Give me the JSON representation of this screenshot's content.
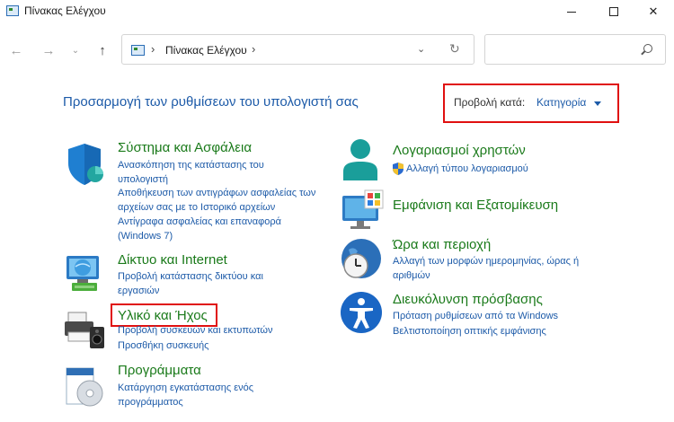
{
  "window": {
    "title": "Πίνακας Ελέγχου",
    "minimize": "─",
    "close": "✕"
  },
  "nav": {
    "back": "←",
    "forward": "→",
    "recent": "⌄",
    "up": "↑"
  },
  "address": {
    "path": "Πίνακας Ελέγχου",
    "separator": "›",
    "dropdown": "⌄",
    "refresh": "↻"
  },
  "search": {
    "placeholder": "",
    "value": ""
  },
  "header": {
    "title": "Προσαρμογή των ρυθμίσεων του υπολογιστή σας",
    "view_by_label": "Προβολή κατά:",
    "view_by_value": "Κατηγορία"
  },
  "categories": {
    "system": {
      "title": "Σύστημα και Ασφάλεια",
      "links": [
        "Ανασκόπηση της κατάστασης του υπολογιστή",
        "Αποθήκευση των αντιγράφων ασφαλείας των αρχείων σας με το Ιστορικό αρχείων",
        "Αντίγραφα ασφαλείας και επαναφορά (Windows 7)"
      ]
    },
    "network": {
      "title": "Δίκτυο και Internet",
      "links": [
        "Προβολή κατάστασης δικτύου και εργασιών"
      ]
    },
    "hardware": {
      "title": "Υλικό και Ήχος",
      "links": [
        "Προβολή συσκευών και εκτυπωτών",
        "Προσθήκη συσκευής"
      ]
    },
    "programs": {
      "title": "Προγράμματα",
      "links": [
        "Κατάργηση εγκατάστασης ενός προγράμματος"
      ]
    },
    "users": {
      "title": "Λογαριασμοί χρηστών",
      "links": [
        "Αλλαγή τύπου λογαριασμού"
      ]
    },
    "appearance": {
      "title": "Εμφάνιση και Εξατομίκευση",
      "links": []
    },
    "clock": {
      "title": "Ώρα και περιοχή",
      "links": [
        "Αλλαγή των μορφών ημερομηνίας, ώρας ή αριθμών"
      ]
    },
    "ease": {
      "title": "Διευκόλυνση πρόσβασης",
      "links": [
        "Πρόταση ρυθμίσεων από τα Windows",
        "Βελτιστοποίηση οπτικής εμφάνισης"
      ]
    }
  }
}
